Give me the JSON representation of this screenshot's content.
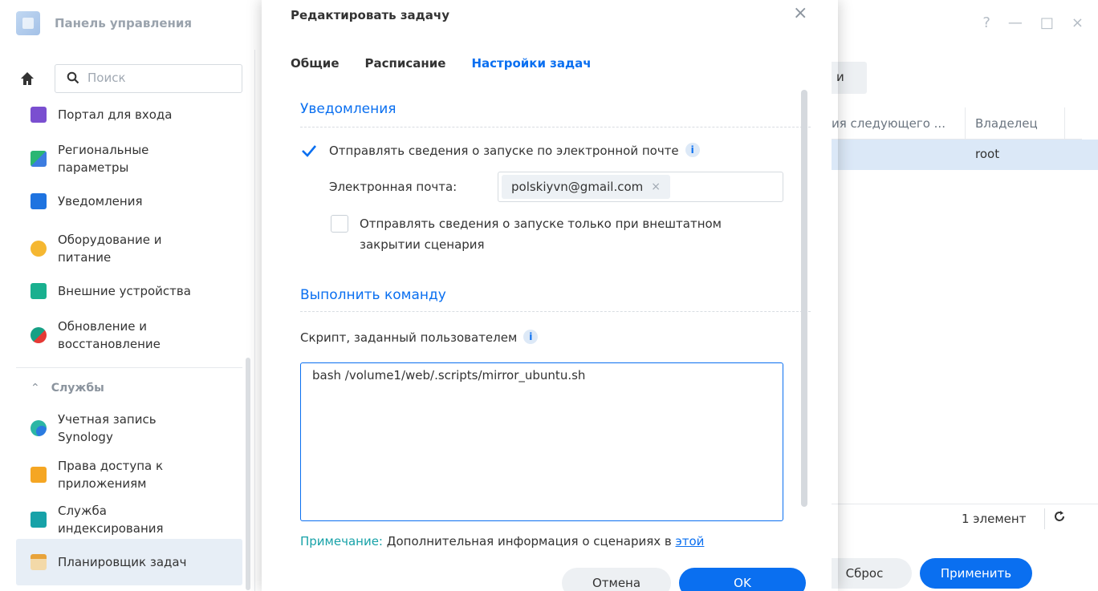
{
  "window": {
    "title": "Панель управления",
    "controls": [
      "?",
      "—",
      "□",
      "×"
    ]
  },
  "sidebar": {
    "search_placeholder": "Поиск",
    "items": [
      {
        "label": "Портал для входа",
        "icon": "login-portal-icon",
        "color": "#7a4fd0"
      },
      {
        "label": "Региональные\nпараметры",
        "icon": "regional-options-icon",
        "color": "#2bb673"
      },
      {
        "label": "Уведомления",
        "icon": "notification-icon",
        "color": "#1e73e0"
      },
      {
        "label": "Оборудование и\nпитание",
        "icon": "hardware-power-icon",
        "color": "#f5b731"
      },
      {
        "label": "Внешние устройства",
        "icon": "external-devices-icon",
        "color": "#19b08f"
      },
      {
        "label": "Обновление и\nвосстановление",
        "icon": "update-restore-icon",
        "color": "#16a085"
      }
    ],
    "section_label": "Службы",
    "service_items": [
      {
        "label": "Учетная запись\nSynology",
        "icon": "synology-account-icon",
        "color": "#2a9fd6"
      },
      {
        "label": "Права доступа к\nприложениям",
        "icon": "app-privileges-icon",
        "color": "#f5a623"
      },
      {
        "label": "Служба\nиндексирования",
        "icon": "indexing-service-icon",
        "color": "#17a2a8"
      },
      {
        "label": "Планировщик задач",
        "icon": "task-scheduler-icon",
        "color": "#e8a33a"
      }
    ]
  },
  "main": {
    "tab_partial": "и",
    "columns": [
      "ия следующего ...",
      "Владелец"
    ],
    "rows": [
      {
        "owner": "root"
      }
    ],
    "count": "1 элемент",
    "reset_label": "Сброс",
    "apply_label": "Применить"
  },
  "dialog": {
    "title": "Редактировать задачу",
    "tabs": [
      "Общие",
      "Расписание",
      "Настройки задач"
    ],
    "active_tab": "Настройки задач",
    "notifications": {
      "title": "Уведомления",
      "send_email_label": "Отправлять сведения о запуске по электронной почте",
      "send_email_checked": true,
      "email_label": "Электронная почта:",
      "email_value": "polskiyvn@gmail.com",
      "abnormal_only_label": "Отправлять сведения о запуске только при внештатном\nзакрытии сценария",
      "abnormal_only_checked": false
    },
    "run_command": {
      "title": "Выполнить команду",
      "script_label": "Скрипт, заданный пользователем",
      "script_value": "bash /volume1/web/.scripts/mirror_ubuntu.sh"
    },
    "note_label": "Примечание:",
    "note_text": " Дополнительная информация о сценариях в ",
    "note_link": "этой",
    "cancel_label": "Отмена",
    "ok_label": "OK"
  },
  "colors": {
    "accent": "#0a6ff0",
    "selected_row": "#dbe8f7",
    "note_label": "#17a2a8"
  }
}
